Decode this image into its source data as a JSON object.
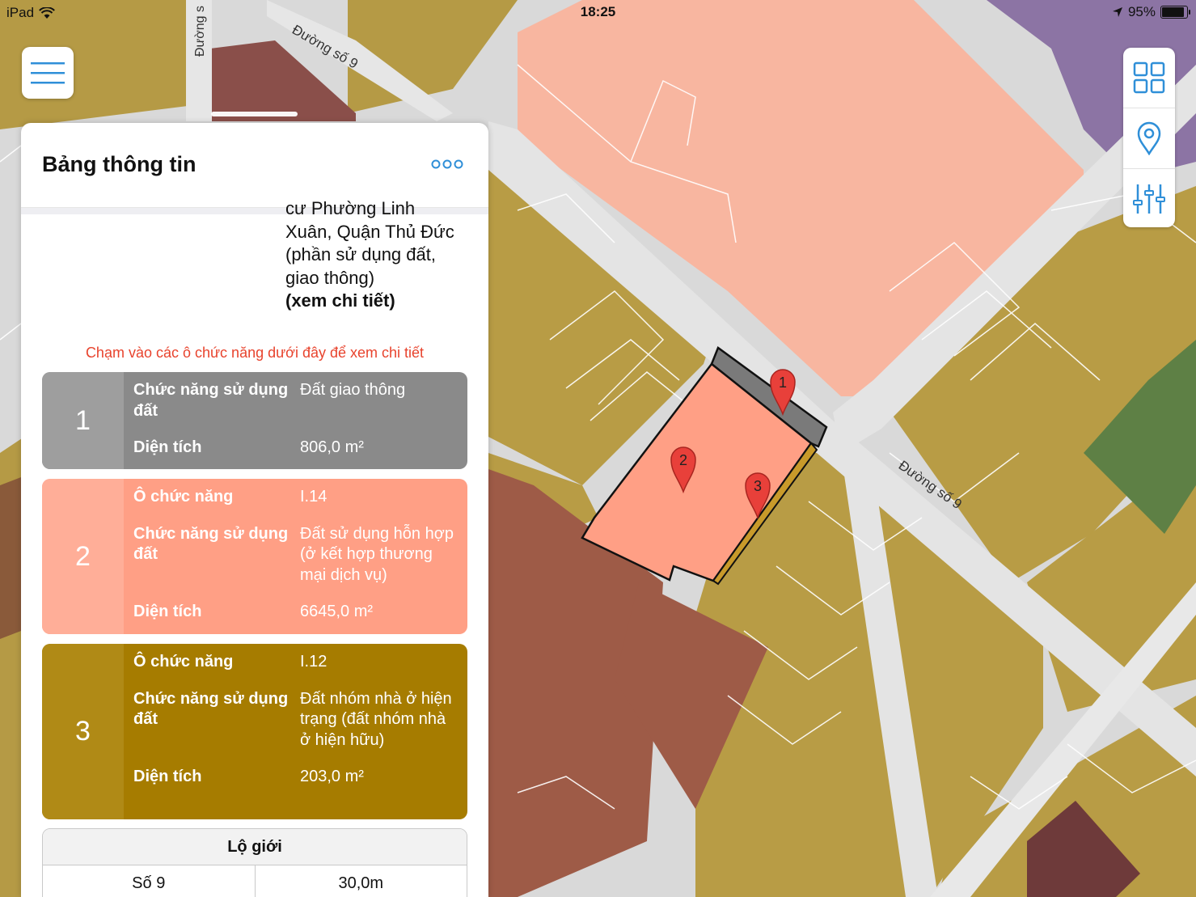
{
  "status_bar": {
    "device": "iPad",
    "time": "18:25",
    "battery": "95%",
    "battery_level": 0.95
  },
  "map": {
    "road_label_top": "Đường số 9",
    "road_label_right": "Đường số 9",
    "road_label_vertical": "Đường s",
    "pins": [
      "1",
      "2",
      "3"
    ]
  },
  "toolbar": {
    "buttons": [
      "grid-icon",
      "location-pin-icon",
      "sliders-icon"
    ]
  },
  "panel": {
    "title": "Bảng thông tin",
    "address_lines": [
      "cư Phường Linh",
      "Xuân, Quận Thủ Đức",
      "(phần sử dụng đất,",
      "giao thông)"
    ],
    "detail_link": "(xem chi tiết)",
    "hint": "Chạm vào các ô chức năng dưới đây để xem chi tiết",
    "cards": [
      {
        "number": "1",
        "color": "#8a8a8a",
        "num_color": "#9e9e9e",
        "rows": [
          {
            "label": "Chức năng sử dụng đất",
            "value": "Đất giao thông"
          },
          {
            "label": "Diện tích",
            "value": "806,0 m²"
          }
        ]
      },
      {
        "number": "2",
        "color": "#ff9f85",
        "num_color": "#ffae98",
        "rows": [
          {
            "label": "Ô chức năng",
            "value": "I.14"
          },
          {
            "label": "Chức năng sử dụng đất",
            "value": "Đất sử dụng hỗn hợp (ở kết hợp thương mại dịch vụ)"
          },
          {
            "label": "Diện tích",
            "value": "6645,0 m²"
          }
        ]
      },
      {
        "number": "3",
        "color": "#a67c00",
        "num_color": "#b08a16",
        "rows": [
          {
            "label": "Ô chức năng",
            "value": "I.12"
          },
          {
            "label": "Chức năng sử dụng đất",
            "value": "Đất nhóm nhà ở hiện trạng (đất nhóm nhà ở hiện hữu)"
          },
          {
            "label": "Diện tích",
            "value": "203,0 m²"
          }
        ]
      }
    ],
    "lo_gioi": {
      "title": "Lộ giới",
      "rows": [
        {
          "road": "Số 9",
          "width": "30,0m"
        }
      ]
    }
  }
}
